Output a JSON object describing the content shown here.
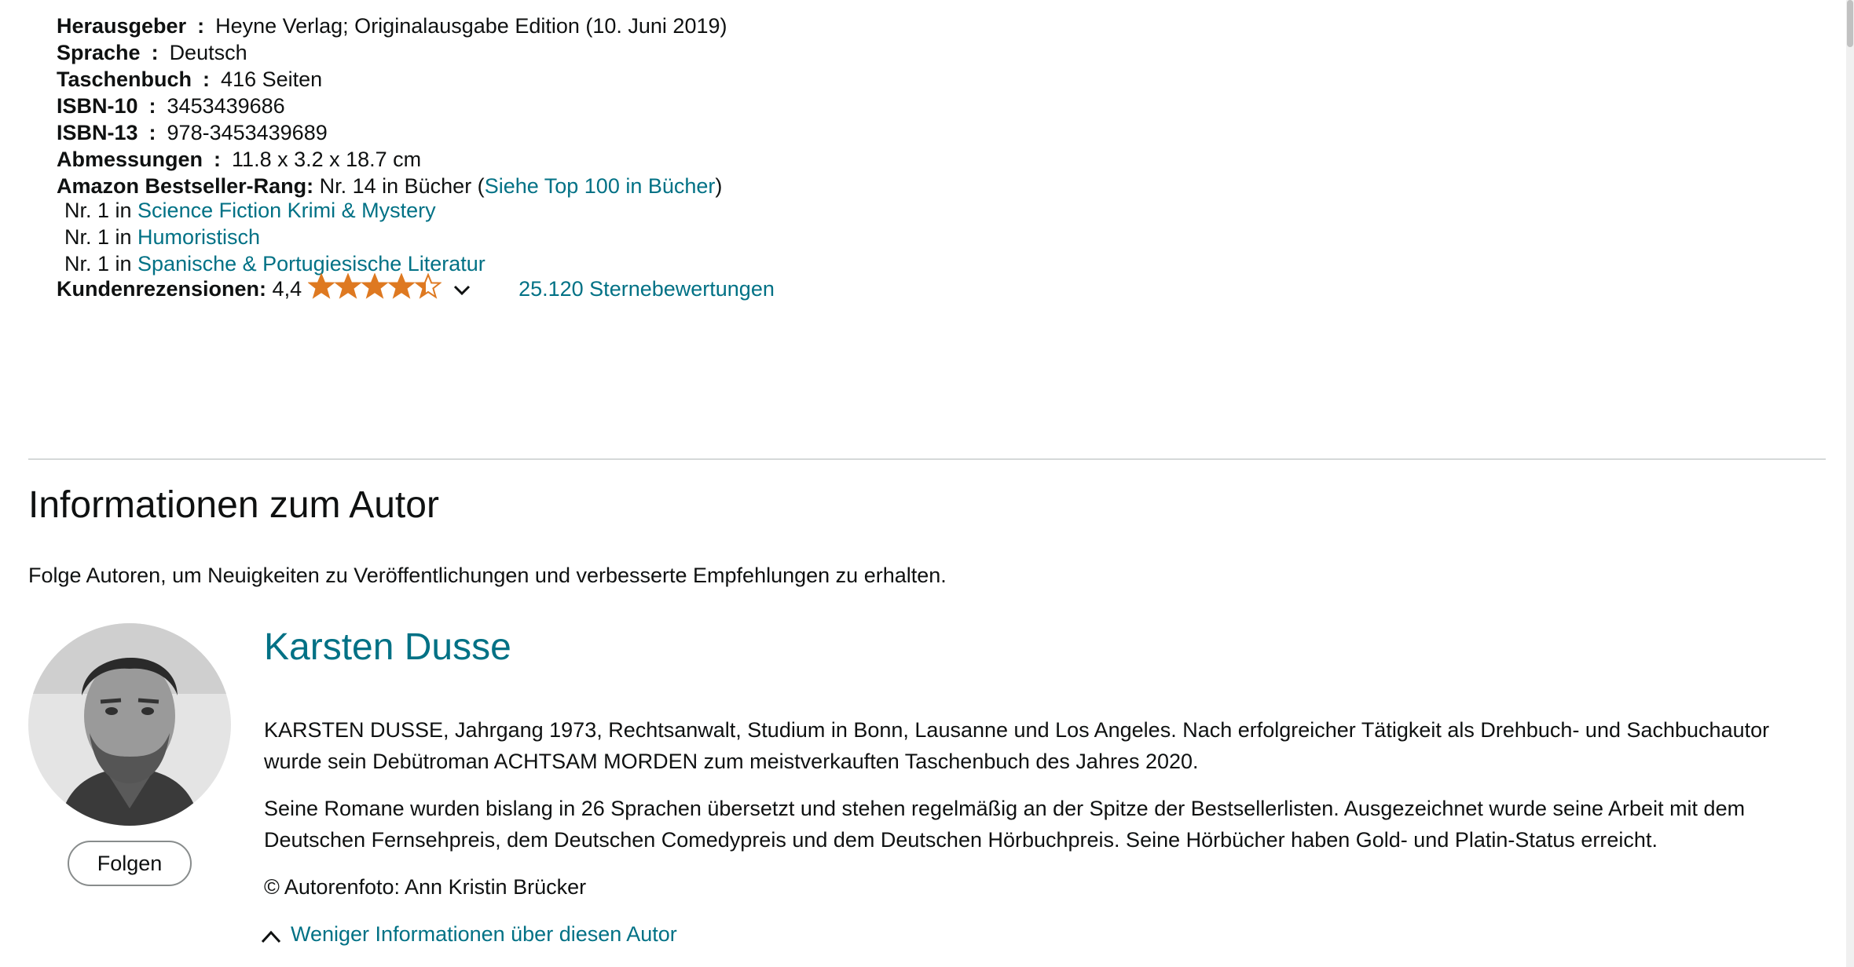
{
  "details": {
    "publisher": {
      "label": "Herausgeber",
      "sep": ":",
      "value": "Heyne Verlag; Originalausgabe Edition (10. Juni 2019)"
    },
    "language": {
      "label": "Sprache",
      "sep": ":",
      "value": "Deutsch"
    },
    "paperback": {
      "label": "Taschenbuch",
      "sep": ":",
      "value": "416 Seiten"
    },
    "isbn10": {
      "label": "ISBN-10",
      "sep": ":",
      "value": "3453439686"
    },
    "isbn13": {
      "label": "ISBN-13",
      "sep": ":",
      "value": "978-3453439689"
    },
    "dimensions": {
      "label": "Abmessungen",
      "sep": ":",
      "value": "11.8 x 3.2 x 18.7 cm"
    },
    "bestseller": {
      "label": "Amazon Bestseller-Rang:",
      "value": " Nr. 14 in Bücher (",
      "link": "Siehe Top 100 in Bücher",
      "close": ")",
      "sub": [
        {
          "prefix": "Nr. 1 in ",
          "link": "Science Fiction Krimi & Mystery"
        },
        {
          "prefix": "Nr. 1 in ",
          "link": "Humoristisch"
        },
        {
          "prefix": "Nr. 1 in ",
          "link": "Spanische & Portugiesische Literatur"
        }
      ]
    },
    "reviews": {
      "label": "Kundenrezensionen:",
      "rating": "4,4",
      "rating_value": 4.4,
      "max_stars": 5,
      "star_color": "#de7921",
      "count_link": "25.120 Sternebewertungen"
    }
  },
  "author_section": {
    "heading": "Informationen zum Autor",
    "follow_note": "Folge Autoren, um Neuigkeiten zu Veröffentlichungen und verbesserte Empfehlungen zu erhalten.",
    "follow_button": "Folgen",
    "name": "Karsten Dusse",
    "bio": [
      "KARSTEN DUSSE, Jahrgang 1973, Rechtsanwalt, Studium in Bonn, Lausanne und Los Angeles. Nach erfolgreicher Tätigkeit als Drehbuch- und Sachbuchautor wurde sein Debütroman ACHTSAM MORDEN zum meistverkauften Taschenbuch des Jahres 2020.",
      "Seine Romane wurden bislang in 26 Sprachen übersetzt und stehen regelmäßig an der Spitze der Bestsellerlisten. Ausgezeichnet wurde seine Arbeit mit dem Deutschen Fernsehpreis, dem Deutschen Comedypreis und dem Deutschen Hörbuchpreis. Seine Hörbücher haben Gold- und Platin-Status erreicht.",
      "© Autorenfoto: Ann Kristin Brücker"
    ],
    "less_link": "Weniger Informationen über diesen Autor"
  },
  "colors": {
    "link": "#007185",
    "star": "#de7921",
    "divider": "#d5d9d9"
  }
}
